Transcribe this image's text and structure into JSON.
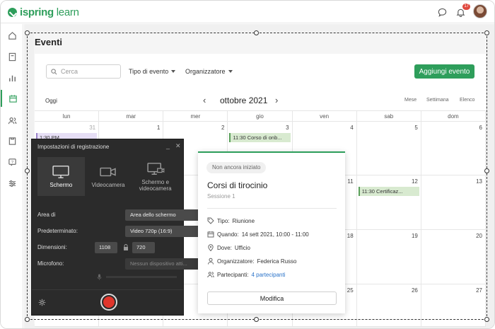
{
  "app": {
    "logo_text": "ispring",
    "logo_text_2": " learn",
    "notification_count": "17",
    "accent": "#2e9e5b"
  },
  "page": {
    "title": "Eventi",
    "search_placeholder": "Cerca",
    "filter_type": "Tipo di evento",
    "filter_organizer": "Organizzatore",
    "add_button": "Aggiungi evento",
    "today": "Oggi",
    "month": "ottobre 2021",
    "views": [
      "Mese",
      "Settimana",
      "Elenco"
    ]
  },
  "calendar": {
    "weekdays": [
      "lun",
      "mar",
      "mer",
      "gio",
      "ven",
      "sab",
      "dom"
    ],
    "weeks": [
      [
        "31",
        "1",
        "2",
        "3",
        "4",
        "5",
        "6"
      ],
      [
        "",
        "",
        "",
        "",
        "11",
        "12",
        "13"
      ],
      [
        "",
        "",
        "",
        "",
        "18",
        "19",
        "20"
      ],
      [
        "",
        "",
        "",
        "",
        "25",
        "26",
        "27"
      ]
    ],
    "events": {
      "mon_w1": "1:30 PM",
      "thu_w1": "11:30 Corso di onb...",
      "sat_w2": "11:30 Certificaz..."
    }
  },
  "recorder": {
    "title": "Impostazioni di registrazione",
    "modes": [
      "Schermo",
      "Videocamera",
      "Schermo e videocamera"
    ],
    "area_label": "Area di",
    "area_value": "Area dello schermo",
    "preset_label": "Predeterminato:",
    "preset_value": "Video 720p (16:9)",
    "size_label": "Dimensioni:",
    "width": "1108",
    "height": "720",
    "mic_label": "Microfono:",
    "mic_value": "Nessun dispositivo atti..."
  },
  "popover": {
    "status": "Non ancora iniziato",
    "title": "Corsi di tirocinio",
    "subtitle": "Sessione 1",
    "type_label": "Tipo:",
    "type_value": "Riunione",
    "when_label": "Quando:",
    "when_value": "14 sett 2021, 10:00 - 11:00",
    "where_label": "Dove:",
    "where_value": "Ufficio",
    "organizer_label": "Organizzatore:",
    "organizer_value": "Federica Russo",
    "participants_label": "Partecipanti:",
    "participants_value": "4 partecipanti",
    "edit_button": "Modifica"
  }
}
